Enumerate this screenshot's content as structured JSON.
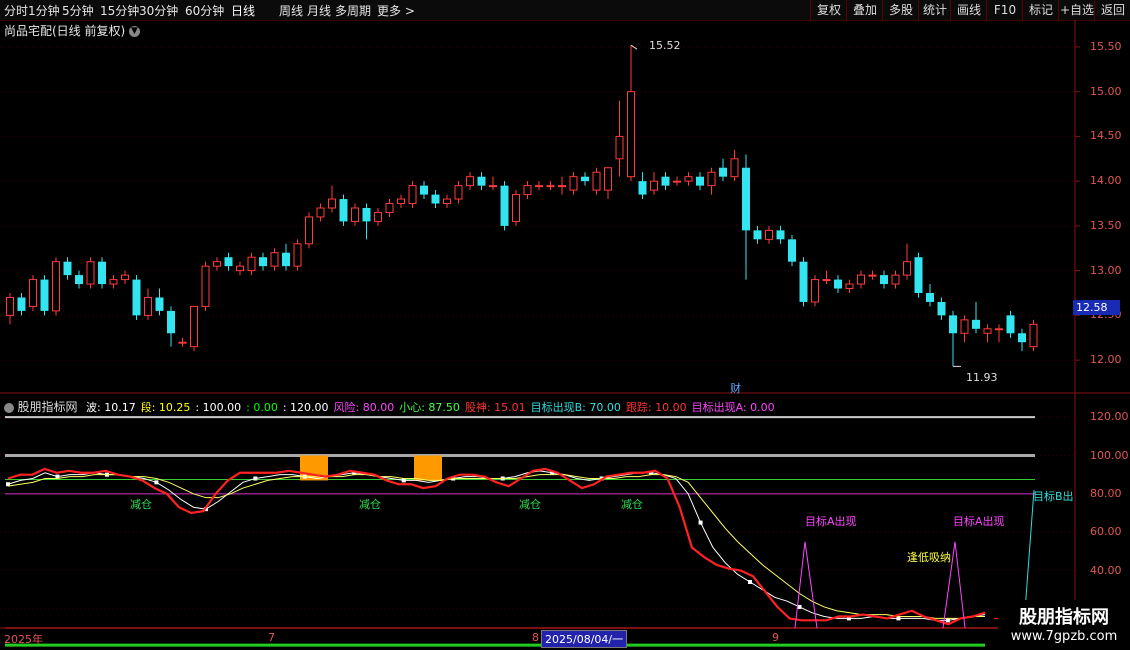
{
  "toolbar": {
    "tabs": [
      "分时",
      "1分钟",
      "5分钟",
      "15分钟",
      "30分钟",
      "60分钟",
      "日线",
      "周线",
      "月线",
      "多周期",
      "更多 >"
    ],
    "active_tab": "日线",
    "right_buttons": [
      "复权",
      "叠加",
      "多股",
      "统计",
      "画线",
      "F10",
      "标记",
      "+自选",
      "返回"
    ]
  },
  "chart_title": "尚品宅配(日线 前复权)",
  "chart_title_icon": "chevron-down-icon",
  "price_axis": [
    "15.50",
    "15.00",
    "14.50",
    "14.00",
    "13.50",
    "13.00",
    "12.50",
    "12.00"
  ],
  "current_price": "12.58",
  "high_marker": "15.52",
  "low_marker": "11.93",
  "cai_marker": "财",
  "indicator": {
    "name": "股朋指标网",
    "items": [
      {
        "text": "波: 10.17",
        "color": "#ffffff"
      },
      {
        "text": "段: 10.25",
        "color": "#ffff00"
      },
      {
        "text": ": 100.00",
        "color": "#ffffff"
      },
      {
        "text": ": 0.00",
        "color": "#00ff00"
      },
      {
        "text": ": 120.00",
        "color": "#ffffff"
      },
      {
        "text": "风险: 80.00",
        "color": "#ff44ff"
      },
      {
        "text": "小心: 87.50",
        "color": "#44ff44"
      },
      {
        "text": "股神: 15.01",
        "color": "#ff3333"
      },
      {
        "text": "目标出现B: 70.00",
        "color": "#33dddd"
      },
      {
        "text": "跟踪: 10.00",
        "color": "#ff3333"
      },
      {
        "text": "目标出现A: 0.00",
        "color": "#ff44ff"
      }
    ]
  },
  "indicator_axis": [
    "120.00",
    "100.00",
    "80.00",
    "60.00",
    "40.00",
    "20.00"
  ],
  "annotations": {
    "reduce": "减仓",
    "target_a": "目标A出现",
    "target_b": "目标B出",
    "low_buy": "逢低吸纳"
  },
  "time_axis": {
    "year": "2025年",
    "m7": "7",
    "m8": "8",
    "date_box": "2025/08/04/一",
    "m9": "9"
  },
  "watermark": {
    "title": "股朋指标网",
    "url": "www.7gpzb.com"
  },
  "colors": {
    "up": "#ff3b3b",
    "down": "#33e5f0",
    "axis": "#8a1010"
  },
  "chart_data": {
    "type": "candlestick",
    "ylim": [
      11.8,
      15.6
    ],
    "candles": [
      [
        12.5,
        12.7,
        12.75,
        12.4
      ],
      [
        12.7,
        12.55,
        12.75,
        12.5
      ],
      [
        12.6,
        12.9,
        12.95,
        12.55
      ],
      [
        12.9,
        12.55,
        12.95,
        12.5
      ],
      [
        12.55,
        13.1,
        13.15,
        12.5
      ],
      [
        13.1,
        12.95,
        13.15,
        12.9
      ],
      [
        12.95,
        12.85,
        13.0,
        12.8
      ],
      [
        12.85,
        13.1,
        13.15,
        12.8
      ],
      [
        13.1,
        12.85,
        13.15,
        12.8
      ],
      [
        12.85,
        12.9,
        12.95,
        12.8
      ],
      [
        12.9,
        12.95,
        13.0,
        12.85
      ],
      [
        12.9,
        12.5,
        12.95,
        12.45
      ],
      [
        12.5,
        12.7,
        12.8,
        12.45
      ],
      [
        12.7,
        12.55,
        12.8,
        12.5
      ],
      [
        12.55,
        12.3,
        12.6,
        12.15
      ],
      [
        12.2,
        12.2,
        12.25,
        12.15
      ],
      [
        12.15,
        12.6,
        12.6,
        12.1
      ],
      [
        12.6,
        13.05,
        13.1,
        12.55
      ],
      [
        13.05,
        13.1,
        13.15,
        13.0
      ],
      [
        13.15,
        13.05,
        13.2,
        13.0
      ],
      [
        13.0,
        13.05,
        13.1,
        12.95
      ],
      [
        13.0,
        13.15,
        13.2,
        12.95
      ],
      [
        13.15,
        13.05,
        13.2,
        13.0
      ],
      [
        13.05,
        13.2,
        13.25,
        13.0
      ],
      [
        13.2,
        13.05,
        13.3,
        13.0
      ],
      [
        13.05,
        13.3,
        13.35,
        13.0
      ],
      [
        13.3,
        13.6,
        13.65,
        13.25
      ],
      [
        13.6,
        13.7,
        13.75,
        13.55
      ],
      [
        13.7,
        13.8,
        13.95,
        13.65
      ],
      [
        13.8,
        13.55,
        13.85,
        13.5
      ],
      [
        13.55,
        13.7,
        13.75,
        13.5
      ],
      [
        13.7,
        13.55,
        13.75,
        13.35
      ],
      [
        13.55,
        13.65,
        13.7,
        13.5
      ],
      [
        13.65,
        13.75,
        13.8,
        13.6
      ],
      [
        13.75,
        13.8,
        13.85,
        13.7
      ],
      [
        13.75,
        13.95,
        14.0,
        13.7
      ],
      [
        13.95,
        13.85,
        14.0,
        13.8
      ],
      [
        13.85,
        13.75,
        13.9,
        13.7
      ],
      [
        13.75,
        13.8,
        13.85,
        13.7
      ],
      [
        13.8,
        13.95,
        14.0,
        13.75
      ],
      [
        13.95,
        14.05,
        14.1,
        13.9
      ],
      [
        14.05,
        13.95,
        14.1,
        13.9
      ],
      [
        13.95,
        13.95,
        14.05,
        13.9
      ],
      [
        13.95,
        13.5,
        14.0,
        13.45
      ],
      [
        13.55,
        13.85,
        13.9,
        13.5
      ],
      [
        13.85,
        13.95,
        14.0,
        13.8
      ],
      [
        13.95,
        13.95,
        14.0,
        13.9
      ],
      [
        13.95,
        13.95,
        14.0,
        13.9
      ],
      [
        13.95,
        13.95,
        14.05,
        13.85
      ],
      [
        13.9,
        14.05,
        14.1,
        13.85
      ],
      [
        14.05,
        14.0,
        14.1,
        13.95
      ],
      [
        13.9,
        14.1,
        14.15,
        13.85
      ],
      [
        13.9,
        14.15,
        14.15,
        13.8
      ],
      [
        14.25,
        14.5,
        14.9,
        14.05
      ],
      [
        14.05,
        15.0,
        15.52,
        14.0
      ],
      [
        14.0,
        13.85,
        14.1,
        13.8
      ],
      [
        13.9,
        14.0,
        14.1,
        13.85
      ],
      [
        14.05,
        13.95,
        14.1,
        13.9
      ],
      [
        14.0,
        14.0,
        14.05,
        13.95
      ],
      [
        14.0,
        14.05,
        14.1,
        13.95
      ],
      [
        14.05,
        13.95,
        14.1,
        13.9
      ],
      [
        13.95,
        14.1,
        14.15,
        13.85
      ],
      [
        14.15,
        14.05,
        14.25,
        14.0
      ],
      [
        14.05,
        14.25,
        14.35,
        14.0
      ],
      [
        14.15,
        13.45,
        14.3,
        12.9
      ],
      [
        13.45,
        13.35,
        13.5,
        13.3
      ],
      [
        13.35,
        13.45,
        13.5,
        13.3
      ],
      [
        13.45,
        13.35,
        13.5,
        13.3
      ],
      [
        13.35,
        13.1,
        13.4,
        13.05
      ],
      [
        13.1,
        12.65,
        13.15,
        12.6
      ],
      [
        12.65,
        12.9,
        12.95,
        12.6
      ],
      [
        12.9,
        12.9,
        13.0,
        12.85
      ],
      [
        12.9,
        12.8,
        12.95,
        12.75
      ],
      [
        12.8,
        12.85,
        12.9,
        12.75
      ],
      [
        12.85,
        12.95,
        13.0,
        12.8
      ],
      [
        12.95,
        12.95,
        13.0,
        12.9
      ],
      [
        12.95,
        12.85,
        13.0,
        12.8
      ],
      [
        12.85,
        12.95,
        13.0,
        12.8
      ],
      [
        12.95,
        13.1,
        13.3,
        12.9
      ],
      [
        13.15,
        12.75,
        13.2,
        12.7
      ],
      [
        12.75,
        12.65,
        12.85,
        12.6
      ],
      [
        12.65,
        12.5,
        12.7,
        12.45
      ],
      [
        12.5,
        12.3,
        12.55,
        11.93
      ],
      [
        12.3,
        12.45,
        12.5,
        12.2
      ],
      [
        12.45,
        12.35,
        12.65,
        12.3
      ],
      [
        12.3,
        12.35,
        12.4,
        12.2
      ],
      [
        12.35,
        12.35,
        12.4,
        12.2
      ],
      [
        12.5,
        12.3,
        12.55,
        12.25
      ],
      [
        12.3,
        12.2,
        12.35,
        12.1
      ],
      [
        12.15,
        12.4,
        12.45,
        12.1
      ]
    ],
    "indicator_ylim": [
      10,
      130
    ],
    "indicator_series": [
      {
        "name": "波",
        "values": [
          85,
          87,
          88,
          91,
          89,
          90,
          90,
          91,
          90,
          90,
          89,
          88,
          86,
          82,
          77,
          73,
          72,
          76,
          81,
          86,
          88,
          89,
          90,
          90,
          89,
          88,
          89,
          90,
          91,
          90,
          89,
          88,
          87,
          87,
          86,
          87,
          88,
          89,
          89,
          88,
          88,
          89,
          91,
          92,
          91,
          90,
          88,
          87,
          88,
          89,
          90,
          91,
          91,
          90,
          88,
          80,
          65,
          52,
          44,
          38,
          34,
          30,
          26,
          24,
          21,
          18,
          16,
          15,
          15,
          15,
          16,
          15,
          15,
          15,
          15,
          14,
          14,
          15,
          16,
          17
        ]
      },
      {
        "name": "段",
        "values": [
          84,
          85,
          86,
          88,
          88,
          89,
          89,
          90,
          90,
          90,
          89,
          89,
          88,
          86,
          83,
          80,
          78,
          78,
          80,
          83,
          85,
          87,
          88,
          89,
          89,
          89,
          89,
          89,
          90,
          90,
          89,
          89,
          88,
          88,
          87,
          87,
          88,
          88,
          88,
          88,
          88,
          88,
          89,
          90,
          90,
          90,
          89,
          88,
          88,
          88,
          89,
          89,
          90,
          90,
          89,
          86,
          78,
          70,
          62,
          55,
          49,
          43,
          38,
          33,
          28,
          24,
          21,
          19,
          18,
          17,
          17,
          17,
          16,
          16,
          16,
          15,
          15,
          15,
          16,
          16
        ]
      },
      {
        "name": "股神",
        "values": [
          88,
          90,
          90,
          93,
          91,
          92,
          91,
          91,
          92,
          90,
          89,
          87,
          83,
          80,
          73,
          70,
          71,
          80,
          87,
          91,
          91,
          91,
          91,
          92,
          91,
          90,
          89,
          90,
          92,
          91,
          90,
          87,
          85,
          85,
          83,
          84,
          88,
          90,
          90,
          89,
          86,
          84,
          88,
          92,
          93,
          91,
          87,
          83,
          85,
          89,
          90,
          91,
          91,
          92,
          88,
          73,
          52,
          47,
          43,
          41,
          40,
          37,
          29,
          21,
          15,
          14,
          14,
          14,
          16,
          16,
          17,
          16,
          15,
          17,
          19,
          16,
          14,
          12,
          15,
          16,
          18
        ]
      }
    ],
    "indicator_levels": {
      "top": 120,
      "upper": 100,
      "careful": 87.5,
      "risk": 80,
      "track": 10
    }
  }
}
